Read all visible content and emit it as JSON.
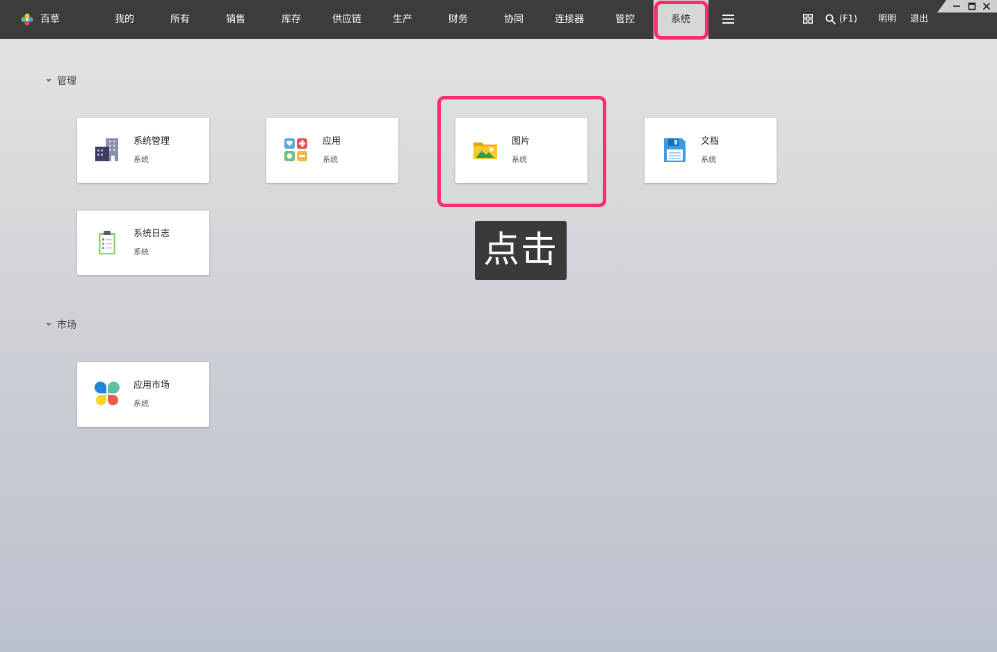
{
  "app": {
    "brand": "百草",
    "logo_icon": "flower-logo-icon"
  },
  "nav": {
    "items": [
      {
        "label": "我的"
      },
      {
        "label": "所有"
      },
      {
        "label": "销售"
      },
      {
        "label": "库存"
      },
      {
        "label": "供应链"
      },
      {
        "label": "生产"
      },
      {
        "label": "财务"
      },
      {
        "label": "协同"
      },
      {
        "label": "连接器"
      },
      {
        "label": "管控"
      },
      {
        "label": "系统",
        "active": true
      }
    ],
    "menu_icon": "hamburger-menu-icon"
  },
  "toolbar": {
    "apps_icon": "grid-icon",
    "search_icon": "search-icon",
    "search_hint": "(F1)",
    "user_name": "明明",
    "logout_label": "退出"
  },
  "window_controls": [
    "minimize-icon",
    "maximize-icon",
    "close-icon"
  ],
  "sections": [
    {
      "title": "管理",
      "cards": [
        {
          "title": "系统管理",
          "subtitle": "系统",
          "icon": "building-icon"
        },
        {
          "title": "应用",
          "subtitle": "系统",
          "icon": "apps-icon"
        },
        {
          "title": "图片",
          "subtitle": "系统",
          "icon": "image-folder-icon"
        },
        {
          "title": "文档",
          "subtitle": "系统",
          "icon": "floppy-disk-icon"
        },
        {
          "title": "系统日志",
          "subtitle": "系统",
          "icon": "clipboard-icon"
        }
      ]
    },
    {
      "title": "市场",
      "cards": [
        {
          "title": "应用市场",
          "subtitle": "系统",
          "icon": "app-market-icon"
        }
      ]
    }
  ],
  "annotation": {
    "click_label": "点击"
  },
  "colors": {
    "topbar": "#3c3c3c",
    "highlight": "#fe2d6c",
    "active_tab": "#d7d7d7"
  }
}
